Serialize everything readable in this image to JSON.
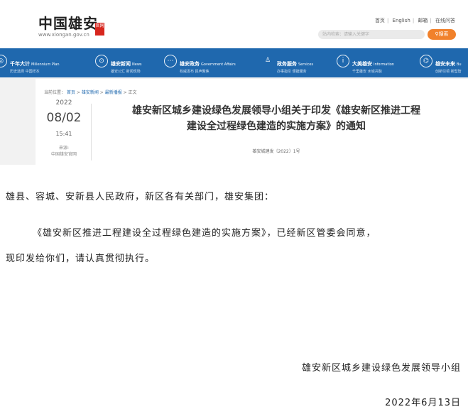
{
  "site": {
    "logo_title": "中国雄安",
    "logo_seal": "官网",
    "url": "www.xiongan.gov.cn",
    "top_links": [
      "首页",
      "English",
      "邮箱",
      "在线问答"
    ],
    "search_placeholder": "站内检索：请输入关键字",
    "search_button": "搜索"
  },
  "nav": [
    {
      "cn": "千年大计",
      "en": "Millennium Plan",
      "sub": "历史选择 中国样本",
      "icon": "globe-icon"
    },
    {
      "cn": "雄安新闻",
      "en": "News",
      "sub": "雄安公汇 新闻现场",
      "icon": "news-icon"
    },
    {
      "cn": "雄安政务",
      "en": "Government Affairs",
      "sub": "权威发布 民声聚焦",
      "icon": "chat-icon"
    },
    {
      "cn": "政务服务",
      "en": "Services",
      "sub": "办事指引 便捷服务",
      "icon": "person-icon"
    },
    {
      "cn": "大美雄安",
      "en": "Information",
      "sub": "千里雄安 水城共融",
      "icon": "info-icon"
    },
    {
      "cn": "雄安未来",
      "en": "Bu",
      "sub": "创新引领 新型智",
      "icon": "compass-icon"
    }
  ],
  "breadcrumb": {
    "label": "当前位置：",
    "items": [
      "首页",
      "雄安新闻",
      "最新播报",
      "正文"
    ]
  },
  "article": {
    "year": "2022",
    "date": "08/02",
    "time": "15:41",
    "source_label": "来源:",
    "source": "中国雄安官网",
    "title_line1": "雄安新区城乡建设绿色发展领导小组关于印发《雄安新区推进工程",
    "title_line2": "建设全过程绿色建造的实施方案》的通知",
    "doc_number": "雄安城建发〔2022〕1号"
  },
  "body": {
    "recipients": "雄县、容城、安新县人民政府，新区各有关部门，雄安集团：",
    "para_line1": "《雄安新区推进工程建设全过程绿色建造的实施方案》，已经新区管委会同意，",
    "para_line2": "现印发给你们，请认真贯彻执行。",
    "signature": "雄安新区城乡建设绿色发展领导小组",
    "date": "2022年6月13日"
  }
}
